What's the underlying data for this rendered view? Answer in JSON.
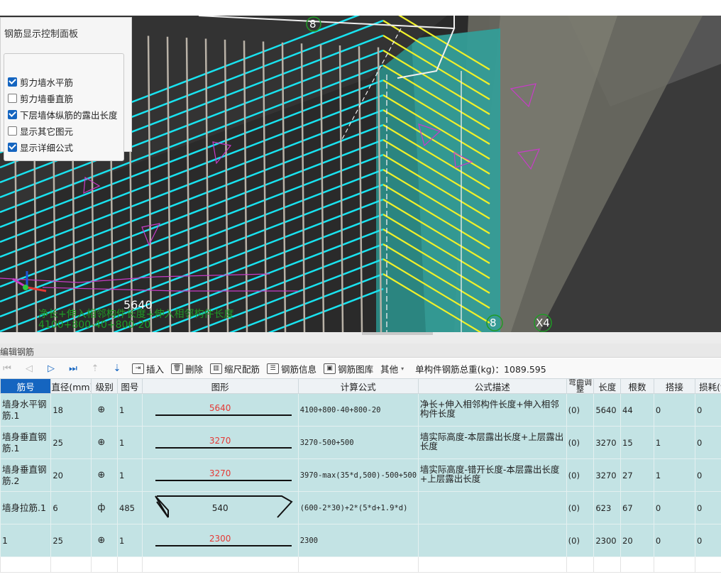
{
  "viewport": {
    "labels": {
      "axis_8_top": "8",
      "axis_8_bottom": "8",
      "axis_x4": "X4",
      "dim_5640": "5640",
      "green_formula_desc": "净长+伸入相邻构件长度+伸入相邻构件长度",
      "green_formula_calc": "4100+800-40+800-20"
    },
    "colors": {
      "rebar_cyan": "#19e3f0",
      "rebar_yellow": "#f0f02a",
      "wall_teal": "#2b8f8a",
      "annotation_magenta": "#c83cc8"
    }
  },
  "control_panel": {
    "title": "钢筋显示控制面板",
    "options": [
      {
        "label": "剪力墙水平筋",
        "checked": true
      },
      {
        "label": "剪力墙垂直筋",
        "checked": false
      },
      {
        "label": "下层墙体纵筋的露出长度",
        "checked": true
      },
      {
        "label": "显示其它图元",
        "checked": false
      },
      {
        "label": "显示详细公式",
        "checked": true
      }
    ]
  },
  "editor": {
    "title": "编辑钢筋",
    "toolbar": {
      "insert": "插入",
      "delete": "删除",
      "scale": "缩尺配筋",
      "info": "钢筋信息",
      "library": "钢筋图库",
      "other": "其他",
      "total": "单构件钢筋总重(kg)：1089.595"
    },
    "columns": [
      "筋号",
      "直径(mm)",
      "级别",
      "图号",
      "图形",
      "计算公式",
      "公式描述",
      "弯曲调整",
      "长度",
      "根数",
      "搭接",
      "损耗(%"
    ],
    "rows": [
      {
        "name": "墙身水平钢筋.1",
        "dia": "18",
        "grade": "⊕",
        "fig": "1",
        "shape": "5640",
        "shape_type": "line",
        "formula": "4100+800-40+800-20",
        "desc": "净长+伸入相邻构件长度+伸入相邻构件长度",
        "bend": "(0)",
        "length": "5640",
        "count": "44",
        "lap": "0",
        "loss": "0"
      },
      {
        "name": "墙身垂直钢筋.1",
        "dia": "25",
        "grade": "⊕",
        "fig": "1",
        "shape": "3270",
        "shape_type": "line",
        "formula": "3270-500+500",
        "desc": "墙实际高度-本层露出长度+上层露出长度",
        "bend": "(0)",
        "length": "3270",
        "count": "15",
        "lap": "1",
        "loss": "0"
      },
      {
        "name": "墙身垂直钢筋.2",
        "dia": "20",
        "grade": "⊕",
        "fig": "1",
        "shape": "3270",
        "shape_type": "line",
        "formula": "3970-max(35*d,500)-500+500",
        "desc": "墙实际高度-错开长度-本层露出长度+上层露出长度",
        "bend": "(0)",
        "length": "3270",
        "count": "27",
        "lap": "1",
        "loss": "0"
      },
      {
        "name": "墙身拉筋.1",
        "dia": "6",
        "grade": "ф",
        "fig": "485",
        "shape": "540",
        "shape_type": "hook",
        "formula": "(600-2*30)+2*(5*d+1.9*d)",
        "desc": "",
        "bend": "(0)",
        "length": "623",
        "count": "67",
        "lap": "0",
        "loss": "0"
      },
      {
        "name": "1",
        "dia": "25",
        "grade": "⊕",
        "fig": "1",
        "shape": "2300",
        "shape_type": "line",
        "formula": "2300",
        "desc": "",
        "bend": "(0)",
        "length": "2300",
        "count": "20",
        "lap": "0",
        "loss": "0"
      }
    ]
  }
}
